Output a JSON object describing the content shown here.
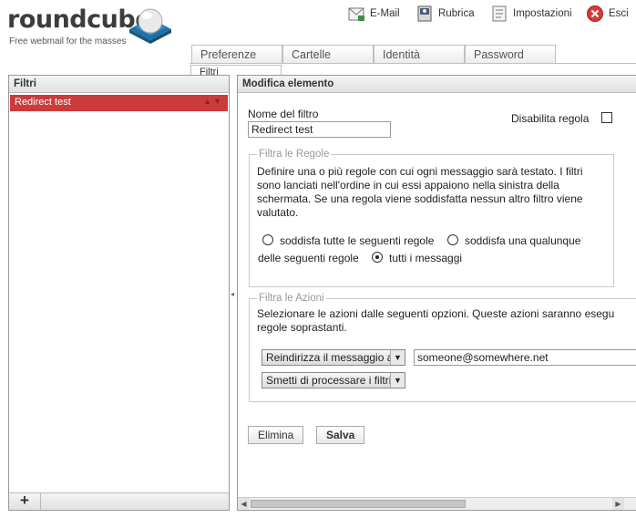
{
  "logo": {
    "name": "roundcube",
    "tagline": "Free webmail for the masses"
  },
  "taskbar": [
    {
      "label": "E-Mail",
      "icon": "mail-icon"
    },
    {
      "label": "Rubrica",
      "icon": "address-book-icon"
    },
    {
      "label": "Impostazioni",
      "icon": "settings-icon"
    },
    {
      "label": "Esci",
      "icon": "logout-icon"
    }
  ],
  "tabs": [
    {
      "label": "Preferenze"
    },
    {
      "label": "Cartelle"
    },
    {
      "label": "Identità"
    },
    {
      "label": "Password"
    },
    {
      "label": "Filtri",
      "active": true
    }
  ],
  "filters": {
    "title": "Filtri",
    "items": [
      {
        "label": "Redirect test",
        "selected": true
      }
    ],
    "add_label": "+"
  },
  "edit": {
    "title": "Modifica elemento",
    "filter_name_label": "Nome del filtro",
    "filter_name_value": "Redirect test",
    "disable_label": "Disabilita regola",
    "disabled": false,
    "rules": {
      "legend": "Filtra le Regole",
      "description": "Definire una o più regole con cui ogni messaggio sarà testato. I filtri sono lanciati nell'ordine in cui essi appaiono nella sinistra della schermata. Se una regola viene soddisfatta nessun altro filtro viene valutato.",
      "option_all": "soddisfa tutte le seguenti regole",
      "option_any": "soddisfa una qualunque",
      "option_any_cont": "delle seguenti regole",
      "option_every": "tutti i messaggi",
      "selected": "every"
    },
    "actions": {
      "legend": "Filtra le Azioni",
      "description_line1": "Selezionare le azioni dalle seguenti opzioni. Queste azioni saranno esegu",
      "description_line2": "regole soprastanti.",
      "action1": "Reindirizza il messaggio a",
      "action1_value": "someone@somewhere.net",
      "action2": "Smetti di processare i filtri"
    },
    "delete_label": "Elimina",
    "save_label": "Salva"
  },
  "colors": {
    "selected_row": "#cd3a3a",
    "accent": "#c0c0c0"
  }
}
